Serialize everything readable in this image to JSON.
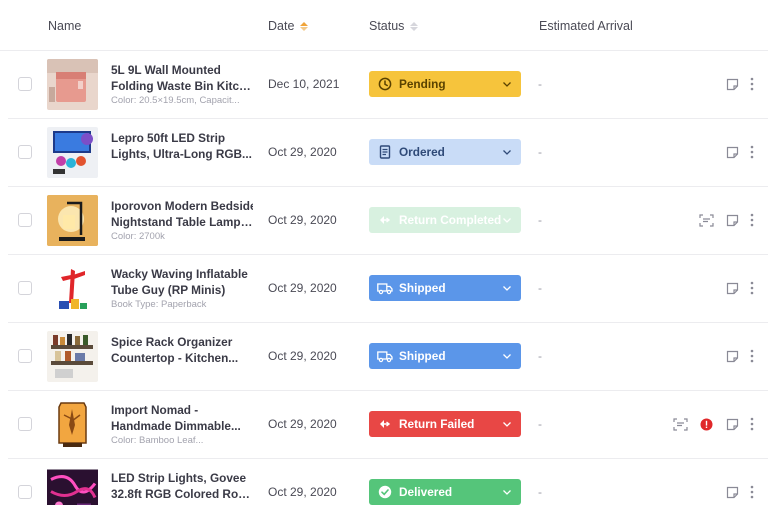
{
  "header": {
    "name_label": "Name",
    "date_label": "Date",
    "status_label": "Status",
    "arrival_label": "Estimated Arrival"
  },
  "colors": {
    "pending": "#f6c43c",
    "ordered": "#c9dcf7",
    "return_completed": "#d8f1e0",
    "shipped": "#5b96e9",
    "return_failed": "#e84745",
    "delivered": "#55c57a"
  },
  "rows": [
    {
      "title_line1": "5L 9L Wall Mounted",
      "title_line2": "Folding Waste Bin Kitch...",
      "meta": "Color: 20.5×19.5cm, Capacit...",
      "date": "Dec 10, 2021",
      "status": "Pending",
      "status_icon": "clock-icon",
      "arrival": "-"
    },
    {
      "title_line1": "Lepro 50ft LED Strip",
      "title_line2": "Lights, Ultra-Long RGB...",
      "meta": "",
      "date": "Oct 29, 2020",
      "status": "Ordered",
      "status_icon": "receipt-icon",
      "arrival": "-"
    },
    {
      "title_line1": "Iporovon Modern Bedside",
      "title_line2": "Nightstand Table Lamp,...",
      "meta": "Color: 2700k",
      "date": "Oct 29, 2020",
      "status": "Return Completed",
      "status_icon": "return-icon",
      "arrival": "-"
    },
    {
      "title_line1": "Wacky Waving Inflatable",
      "title_line2": "Tube Guy (RP Minis)",
      "meta": "Book Type: Paperback",
      "date": "Oct 29, 2020",
      "status": "Shipped",
      "status_icon": "truck-icon",
      "arrival": "-"
    },
    {
      "title_line1": "Spice Rack Organizer",
      "title_line2": "Countertop - Kitchen...",
      "meta": "",
      "date": "Oct 29, 2020",
      "status": "Shipped",
      "status_icon": "truck-icon",
      "arrival": "-"
    },
    {
      "title_line1": "Import Nomad -",
      "title_line2": "Handmade Dimmable...",
      "meta": "Color: Bamboo Leaf...",
      "date": "Oct 29, 2020",
      "status": "Return Failed",
      "status_icon": "return-icon",
      "arrival": "-"
    },
    {
      "title_line1": "LED Strip Lights, Govee",
      "title_line2": "32.8ft RGB Colored Rop...",
      "meta": "",
      "date": "Oct 29, 2020",
      "status": "Delivered",
      "status_icon": "check-circle-icon",
      "arrival": "-"
    }
  ]
}
